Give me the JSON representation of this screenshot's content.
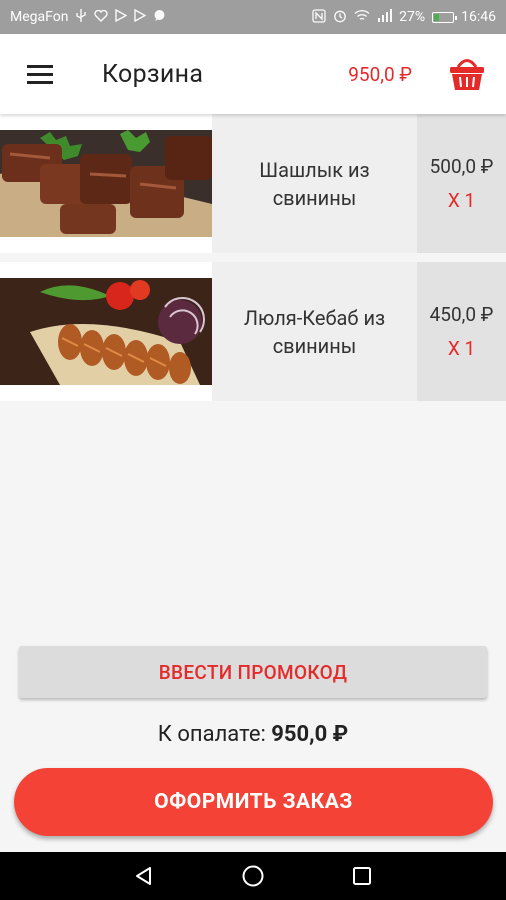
{
  "status_bar": {
    "carrier": "MegaFon",
    "battery_percent": "27%",
    "battery_level": 0.27,
    "time": "16:46",
    "left_icons": [
      "usb-icon",
      "heart-icon",
      "play-store-icon",
      "play-store-icon",
      "chat-icon"
    ],
    "right_icons": [
      "nfc-icon",
      "alarm-icon",
      "wifi-icon",
      "signal-icon",
      "battery-icon"
    ]
  },
  "app_bar": {
    "title": "Корзина",
    "total": "950,0 ₽",
    "menu_icon": "menu-icon",
    "basket_icon": "basket-icon"
  },
  "cart": {
    "items": [
      {
        "name": "Шашлык из свинины",
        "price": "500,0 ₽",
        "qty": "X 1",
        "image": "grilled-pork-shashlik"
      },
      {
        "name": "Люля-Кебаб из свинины",
        "price": "450,0 ₽",
        "qty": "X 1",
        "image": "lula-kebab-skewers"
      }
    ]
  },
  "promo": {
    "label": "ВВЕСТИ ПРОМОКОД"
  },
  "summary": {
    "label": "К опалате:",
    "amount": "950,0 ₽"
  },
  "checkout": {
    "label": "ОФОРМИТЬ ЗАКАЗ"
  },
  "colors": {
    "accent": "#e52a2a",
    "button": "#f44336",
    "status_bar": "#9e9e9e"
  },
  "nav_bar": {
    "icons": [
      "back-icon",
      "home-icon",
      "recents-icon"
    ]
  }
}
